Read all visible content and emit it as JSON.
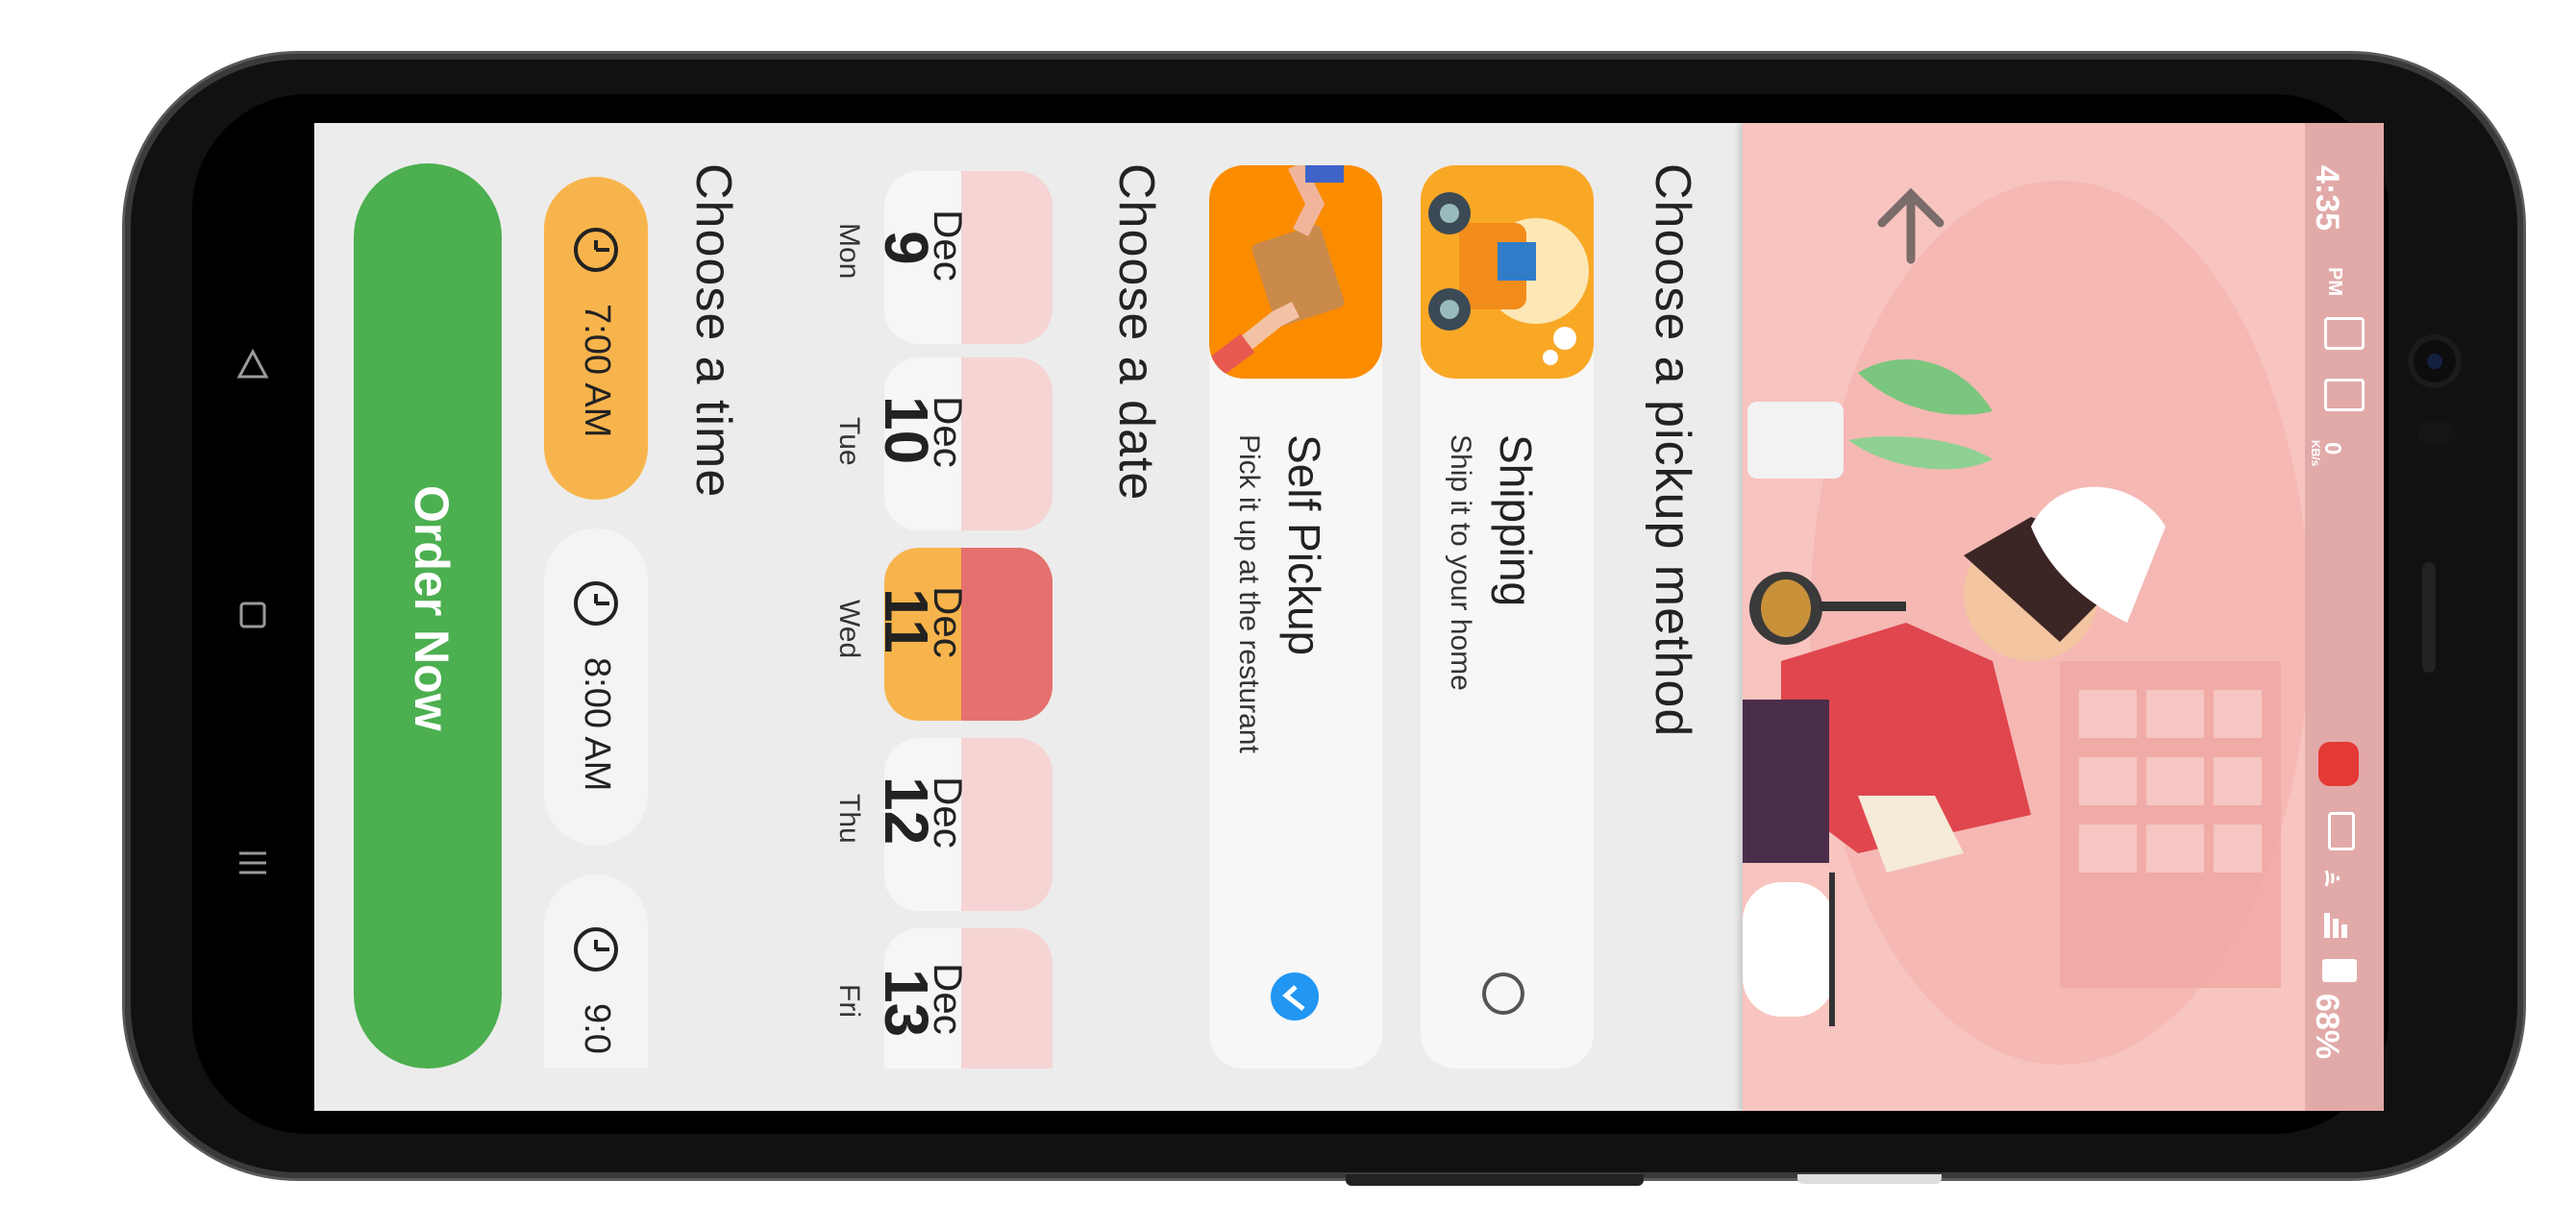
{
  "status_bar": {
    "time": "4:35",
    "ampm": "PM",
    "net_speed": "0",
    "net_unit": "KB/s",
    "battery": "68%"
  },
  "hero": {
    "back_icon": "arrow-up-icon"
  },
  "pickup": {
    "title": "Choose a pickup method",
    "options": [
      {
        "title": "Shipping",
        "subtitle": "Ship it to your home",
        "selected": false,
        "icon": "scooter-delivery-illustration"
      },
      {
        "title": "Self Pickup",
        "subtitle": "Pick it up at the resturant",
        "selected": true,
        "icon": "package-handoff-illustration"
      }
    ]
  },
  "date": {
    "title": "Choose a date",
    "days": [
      {
        "month": "Dec",
        "day": "9",
        "weekday": "Mon",
        "selected": false
      },
      {
        "month": "Dec",
        "day": "10",
        "weekday": "Tue",
        "selected": false
      },
      {
        "month": "Dec",
        "day": "11",
        "weekday": "Wed",
        "selected": true
      },
      {
        "month": "Dec",
        "day": "12",
        "weekday": "Thu",
        "selected": false
      },
      {
        "month": "Dec",
        "day": "13",
        "weekday": "Fri",
        "selected": false
      }
    ]
  },
  "time": {
    "title": "Choose a time",
    "slots": [
      {
        "label": "7:00 AM",
        "selected": true
      },
      {
        "label": "8:00 AM",
        "selected": false
      },
      {
        "label": "9:0",
        "selected": false
      }
    ]
  },
  "order_button": "Order Now",
  "colors": {
    "accent_orange": "#f8b44c",
    "month_red": "#e4716f",
    "order_green": "#4caf50",
    "check_blue": "#2196f3"
  }
}
